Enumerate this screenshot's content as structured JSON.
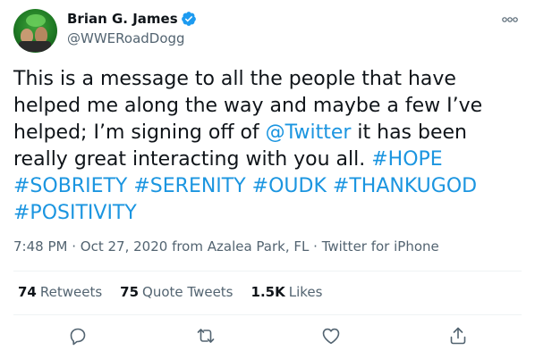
{
  "author": {
    "name": "Brian G. James",
    "handle": "@WWERoadDogg",
    "verified": true
  },
  "tweet": {
    "segments": [
      {
        "text": "This is a message to all the people that have helped me along the way and maybe a few I’ve helped; I’m signing off of ",
        "type": "text"
      },
      {
        "text": "@Twitter",
        "type": "mention"
      },
      {
        "text": " it has been really great interacting with you all. ",
        "type": "text"
      },
      {
        "text": "#HOPE",
        "type": "hashtag"
      },
      {
        "text": " ",
        "type": "text"
      },
      {
        "text": "#SOBRIETY",
        "type": "hashtag"
      },
      {
        "text": " ",
        "type": "text"
      },
      {
        "text": "#SERENITY",
        "type": "hashtag"
      },
      {
        "text": " ",
        "type": "text"
      },
      {
        "text": "#OUDK",
        "type": "hashtag"
      },
      {
        "text": " ",
        "type": "text"
      },
      {
        "text": "#THANKUGOD",
        "type": "hashtag"
      },
      {
        "text": " ",
        "type": "text"
      },
      {
        "text": "#POSITIVITY",
        "type": "hashtag"
      }
    ]
  },
  "meta": {
    "time": "7:48 PM",
    "date": "Oct 27, 2020",
    "location": "from Azalea Park, FL",
    "source": "Twitter for iPhone"
  },
  "stats": {
    "retweets": {
      "count": "74",
      "label": "Retweets"
    },
    "quote_tweets": {
      "count": "75",
      "label": "Quote Tweets"
    },
    "likes": {
      "count": "1.5K",
      "label": "Likes"
    }
  },
  "actions": {
    "reply_icon": "reply-icon",
    "retweet_icon": "retweet-icon",
    "like_icon": "heart-icon",
    "share_icon": "share-icon"
  },
  "colors": {
    "link": "#1b95e0",
    "verified": "#1d9bf0",
    "secondary_text": "#536471"
  }
}
